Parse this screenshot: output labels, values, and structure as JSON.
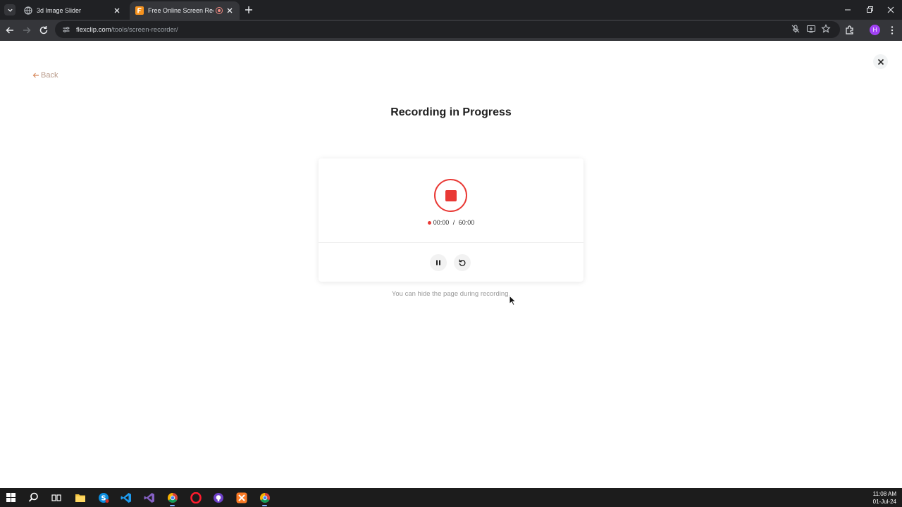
{
  "browser": {
    "tabs": [
      {
        "title": "3d Image Slider",
        "active": false
      },
      {
        "title": "Free Online Screen Recorde",
        "active": true
      }
    ],
    "url_host": "flexclip.com",
    "url_path": "/tools/screen-recorder/",
    "profile_initial": "H"
  },
  "page": {
    "back_label": "Back",
    "title": "Recording in Progress",
    "timer_elapsed": "00:00",
    "timer_separator": " / ",
    "timer_limit": "60:00",
    "hint": "You can hide the page during recording."
  },
  "taskbar": {
    "time": "11:08 AM",
    "date": "01-Jul-24"
  },
  "colors": {
    "record_red": "#e93935",
    "back_link": "#b89a8a",
    "chrome_dark": "#202124",
    "chrome_mid": "#35363a"
  }
}
